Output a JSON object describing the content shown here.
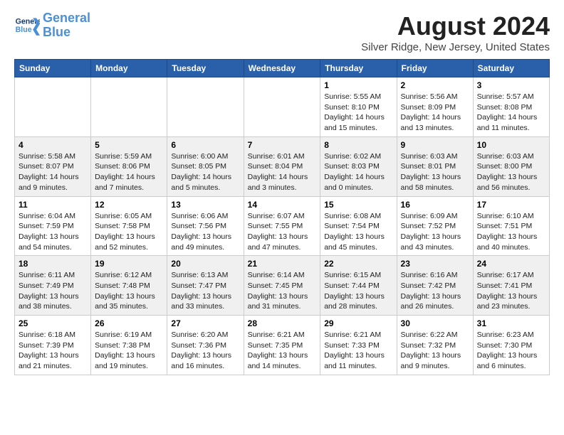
{
  "logo": {
    "line1": "General",
    "line2": "Blue"
  },
  "title": "August 2024",
  "location": "Silver Ridge, New Jersey, United States",
  "weekdays": [
    "Sunday",
    "Monday",
    "Tuesday",
    "Wednesday",
    "Thursday",
    "Friday",
    "Saturday"
  ],
  "weeks": [
    [
      {
        "day": "",
        "info": ""
      },
      {
        "day": "",
        "info": ""
      },
      {
        "day": "",
        "info": ""
      },
      {
        "day": "",
        "info": ""
      },
      {
        "day": "1",
        "info": "Sunrise: 5:55 AM\nSunset: 8:10 PM\nDaylight: 14 hours\nand 15 minutes."
      },
      {
        "day": "2",
        "info": "Sunrise: 5:56 AM\nSunset: 8:09 PM\nDaylight: 14 hours\nand 13 minutes."
      },
      {
        "day": "3",
        "info": "Sunrise: 5:57 AM\nSunset: 8:08 PM\nDaylight: 14 hours\nand 11 minutes."
      }
    ],
    [
      {
        "day": "4",
        "info": "Sunrise: 5:58 AM\nSunset: 8:07 PM\nDaylight: 14 hours\nand 9 minutes."
      },
      {
        "day": "5",
        "info": "Sunrise: 5:59 AM\nSunset: 8:06 PM\nDaylight: 14 hours\nand 7 minutes."
      },
      {
        "day": "6",
        "info": "Sunrise: 6:00 AM\nSunset: 8:05 PM\nDaylight: 14 hours\nand 5 minutes."
      },
      {
        "day": "7",
        "info": "Sunrise: 6:01 AM\nSunset: 8:04 PM\nDaylight: 14 hours\nand 3 minutes."
      },
      {
        "day": "8",
        "info": "Sunrise: 6:02 AM\nSunset: 8:03 PM\nDaylight: 14 hours\nand 0 minutes."
      },
      {
        "day": "9",
        "info": "Sunrise: 6:03 AM\nSunset: 8:01 PM\nDaylight: 13 hours\nand 58 minutes."
      },
      {
        "day": "10",
        "info": "Sunrise: 6:03 AM\nSunset: 8:00 PM\nDaylight: 13 hours\nand 56 minutes."
      }
    ],
    [
      {
        "day": "11",
        "info": "Sunrise: 6:04 AM\nSunset: 7:59 PM\nDaylight: 13 hours\nand 54 minutes."
      },
      {
        "day": "12",
        "info": "Sunrise: 6:05 AM\nSunset: 7:58 PM\nDaylight: 13 hours\nand 52 minutes."
      },
      {
        "day": "13",
        "info": "Sunrise: 6:06 AM\nSunset: 7:56 PM\nDaylight: 13 hours\nand 49 minutes."
      },
      {
        "day": "14",
        "info": "Sunrise: 6:07 AM\nSunset: 7:55 PM\nDaylight: 13 hours\nand 47 minutes."
      },
      {
        "day": "15",
        "info": "Sunrise: 6:08 AM\nSunset: 7:54 PM\nDaylight: 13 hours\nand 45 minutes."
      },
      {
        "day": "16",
        "info": "Sunrise: 6:09 AM\nSunset: 7:52 PM\nDaylight: 13 hours\nand 43 minutes."
      },
      {
        "day": "17",
        "info": "Sunrise: 6:10 AM\nSunset: 7:51 PM\nDaylight: 13 hours\nand 40 minutes."
      }
    ],
    [
      {
        "day": "18",
        "info": "Sunrise: 6:11 AM\nSunset: 7:49 PM\nDaylight: 13 hours\nand 38 minutes."
      },
      {
        "day": "19",
        "info": "Sunrise: 6:12 AM\nSunset: 7:48 PM\nDaylight: 13 hours\nand 35 minutes."
      },
      {
        "day": "20",
        "info": "Sunrise: 6:13 AM\nSunset: 7:47 PM\nDaylight: 13 hours\nand 33 minutes."
      },
      {
        "day": "21",
        "info": "Sunrise: 6:14 AM\nSunset: 7:45 PM\nDaylight: 13 hours\nand 31 minutes."
      },
      {
        "day": "22",
        "info": "Sunrise: 6:15 AM\nSunset: 7:44 PM\nDaylight: 13 hours\nand 28 minutes."
      },
      {
        "day": "23",
        "info": "Sunrise: 6:16 AM\nSunset: 7:42 PM\nDaylight: 13 hours\nand 26 minutes."
      },
      {
        "day": "24",
        "info": "Sunrise: 6:17 AM\nSunset: 7:41 PM\nDaylight: 13 hours\nand 23 minutes."
      }
    ],
    [
      {
        "day": "25",
        "info": "Sunrise: 6:18 AM\nSunset: 7:39 PM\nDaylight: 13 hours\nand 21 minutes."
      },
      {
        "day": "26",
        "info": "Sunrise: 6:19 AM\nSunset: 7:38 PM\nDaylight: 13 hours\nand 19 minutes."
      },
      {
        "day": "27",
        "info": "Sunrise: 6:20 AM\nSunset: 7:36 PM\nDaylight: 13 hours\nand 16 minutes."
      },
      {
        "day": "28",
        "info": "Sunrise: 6:21 AM\nSunset: 7:35 PM\nDaylight: 13 hours\nand 14 minutes."
      },
      {
        "day": "29",
        "info": "Sunrise: 6:21 AM\nSunset: 7:33 PM\nDaylight: 13 hours\nand 11 minutes."
      },
      {
        "day": "30",
        "info": "Sunrise: 6:22 AM\nSunset: 7:32 PM\nDaylight: 13 hours\nand 9 minutes."
      },
      {
        "day": "31",
        "info": "Sunrise: 6:23 AM\nSunset: 7:30 PM\nDaylight: 13 hours\nand 6 minutes."
      }
    ]
  ]
}
